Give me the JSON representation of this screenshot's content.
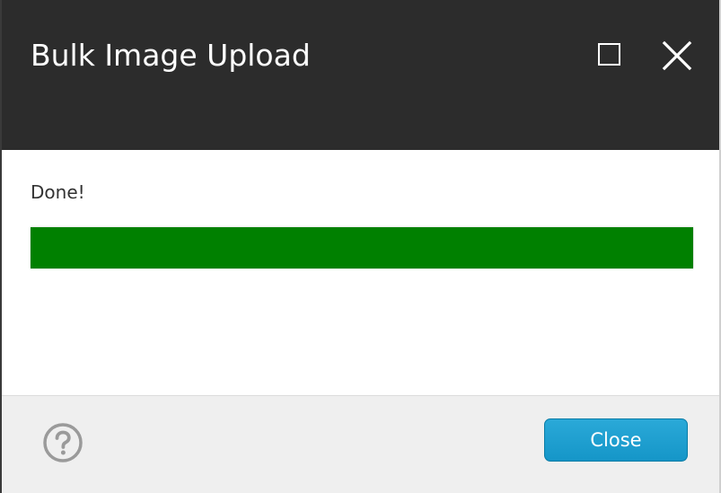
{
  "dialog": {
    "title": "Bulk Image Upload",
    "title_bar_color": "#2c2c2c"
  },
  "window_controls": {
    "maximize_icon": "maximize-icon",
    "close_icon": "close-icon"
  },
  "content": {
    "status_text": "Done!",
    "progress": {
      "value": 1.0,
      "fill_color": "#008000"
    }
  },
  "footer": {
    "help_icon": "question-circle-icon",
    "close_label": "Close",
    "close_button_color": "#1a9fd0"
  }
}
